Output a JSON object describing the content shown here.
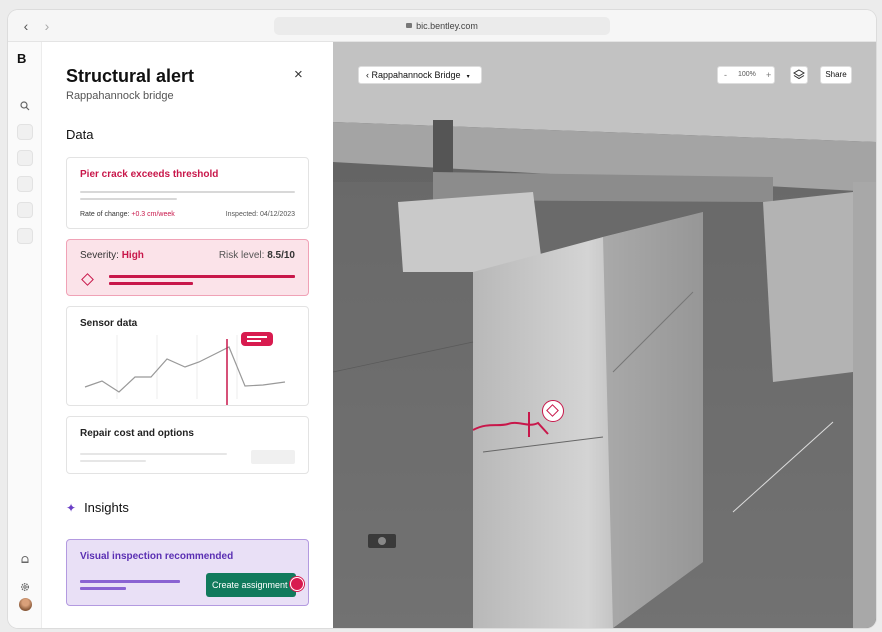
{
  "browser": {
    "back": "‹",
    "forward": "›",
    "url": "bic.bentley.com"
  },
  "rail": {
    "logo": "B"
  },
  "panel": {
    "title": "Structural alert",
    "subtitle": "Rappahannock bridge",
    "close": "×",
    "data_heading": "Data",
    "pier_card": {
      "title": "Pier crack exceeds threshold",
      "rate_label": "Rate of change: ",
      "rate_value": "+0.3 cm/week",
      "inspected": "Inspected: 04/12/2023"
    },
    "severity_card": {
      "severity_label": "Severity: ",
      "severity_value": "High",
      "risk_label": "Risk level: ",
      "risk_value": "8.5/10"
    },
    "sensor_card": {
      "title": "Sensor data"
    },
    "repair_card": {
      "title": "Repair cost and options"
    },
    "insights_heading": "Insights",
    "insight_card": {
      "title": "Visual inspection recommended",
      "button": "Create assignment"
    }
  },
  "viewer": {
    "breadcrumb": "Rappahannock Bridge",
    "zoom_minus": "-",
    "zoom": "100%",
    "zoom_plus": "+",
    "share": "Share"
  },
  "colors": {
    "accent": "#c8174a",
    "success": "#117a5c",
    "insight": "#5a2fb3"
  }
}
